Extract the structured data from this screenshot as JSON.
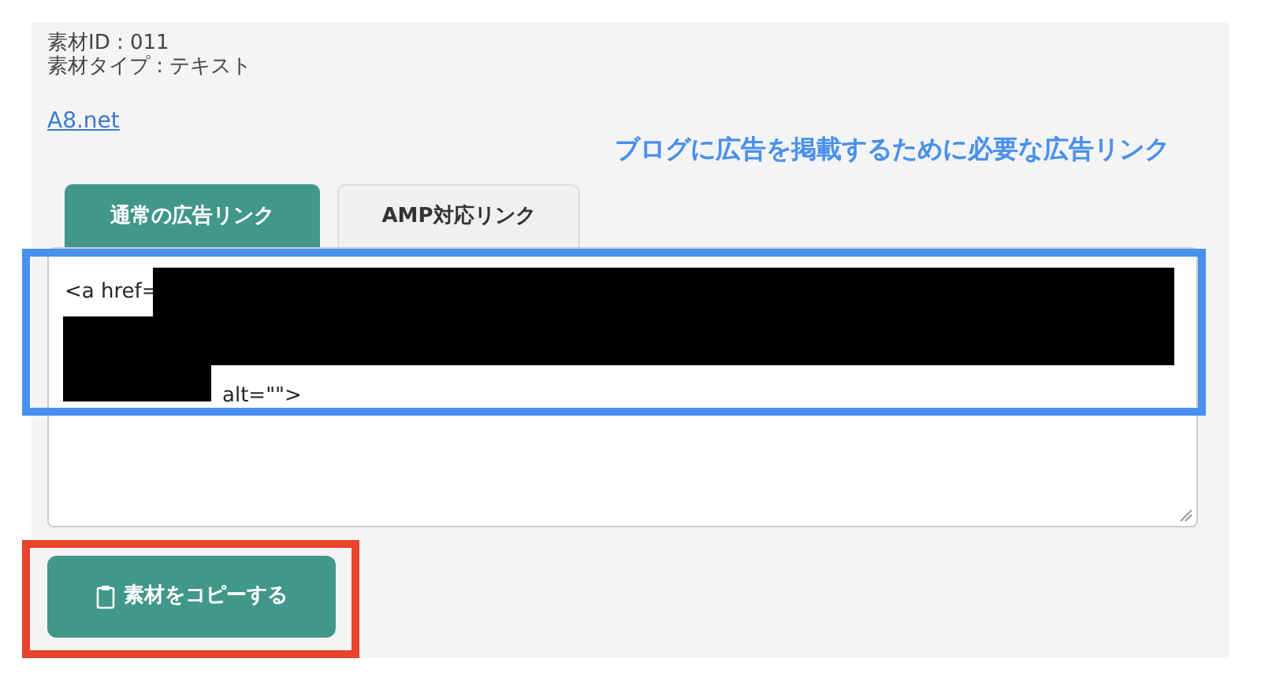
{
  "material": {
    "id_line": "素材ID : 011",
    "type_line": "素材タイプ : テキスト",
    "advertiser_link": "A8.net"
  },
  "tabs": [
    {
      "label": "通常の広告リンク",
      "selected": true
    },
    {
      "label": "AMP対応リンク",
      "selected": false
    }
  ],
  "code_field": {
    "lines": [
      "<a href=",
      "alt=\"\">"
    ]
  },
  "copy_button": {
    "label": "素材をコピーする"
  },
  "annotations": [
    {
      "kind": "note",
      "text": "ブログに広告を掲載するために必要な広告リンク",
      "color": "#4a90ee"
    },
    {
      "kind": "frame",
      "color": "#4a90ee"
    },
    {
      "kind": "frame",
      "color": "#e8442c"
    }
  ]
}
